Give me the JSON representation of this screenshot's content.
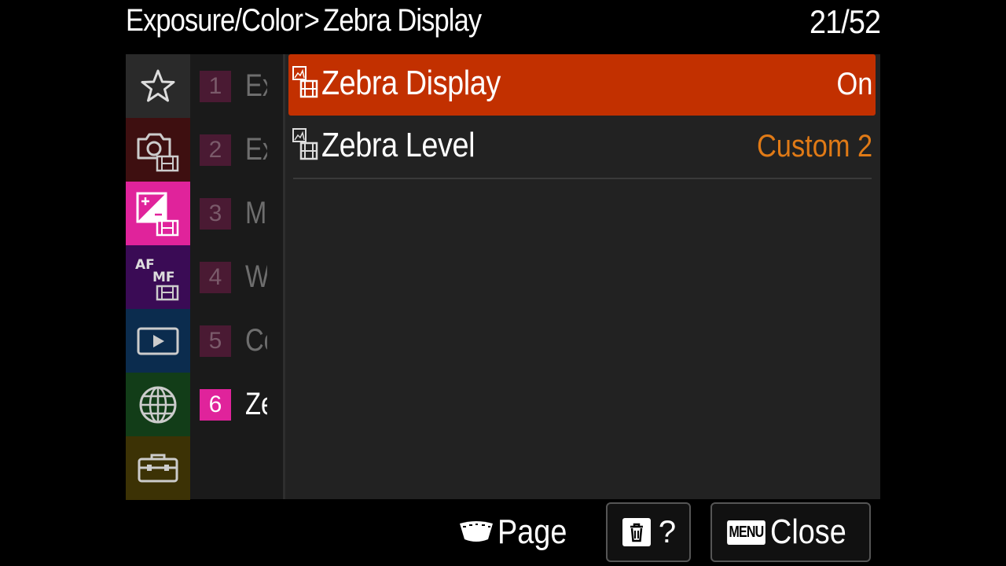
{
  "header": {
    "breadcrumb_parent": "Exposure/Color",
    "breadcrumb_separator": ">",
    "breadcrumb_current": "Zebra Display",
    "page_counter": "21/52"
  },
  "categories": [
    {
      "icon": "star-icon",
      "color": "#2a2a2a"
    },
    {
      "icon": "camera-movie-icon",
      "color": "#3e0f10"
    },
    {
      "icon": "exposure-movie-icon",
      "color": "#e0239b",
      "selected": true
    },
    {
      "icon": "af-mf-movie-icon",
      "color": "#3a0b55"
    },
    {
      "icon": "playback-icon",
      "color": "#0b2c4e"
    },
    {
      "icon": "globe-icon",
      "color": "#123d18"
    },
    {
      "icon": "toolbox-icon",
      "color": "#3c3205"
    }
  ],
  "pages": [
    {
      "num": "1",
      "label": "Ex"
    },
    {
      "num": "2",
      "label": "Ex"
    },
    {
      "num": "3",
      "label": "Mo"
    },
    {
      "num": "4",
      "label": "W"
    },
    {
      "num": "5",
      "label": "Co"
    },
    {
      "num": "6",
      "label": "Ze"
    }
  ],
  "menu_items": [
    {
      "name": "Zebra Display",
      "value": "On",
      "icon": "still-movie-icon"
    },
    {
      "name": "Zebra Level",
      "value": "Custom 2",
      "icon": "still-movie-icon"
    }
  ],
  "footer": {
    "page_label": "Page",
    "help_symbol": "?",
    "menu_tag": "MENU",
    "close_label": "Close"
  },
  "colors": {
    "selected_item": "#c23000",
    "value_accent": "#e07a16",
    "active_page": "#e0239b"
  }
}
